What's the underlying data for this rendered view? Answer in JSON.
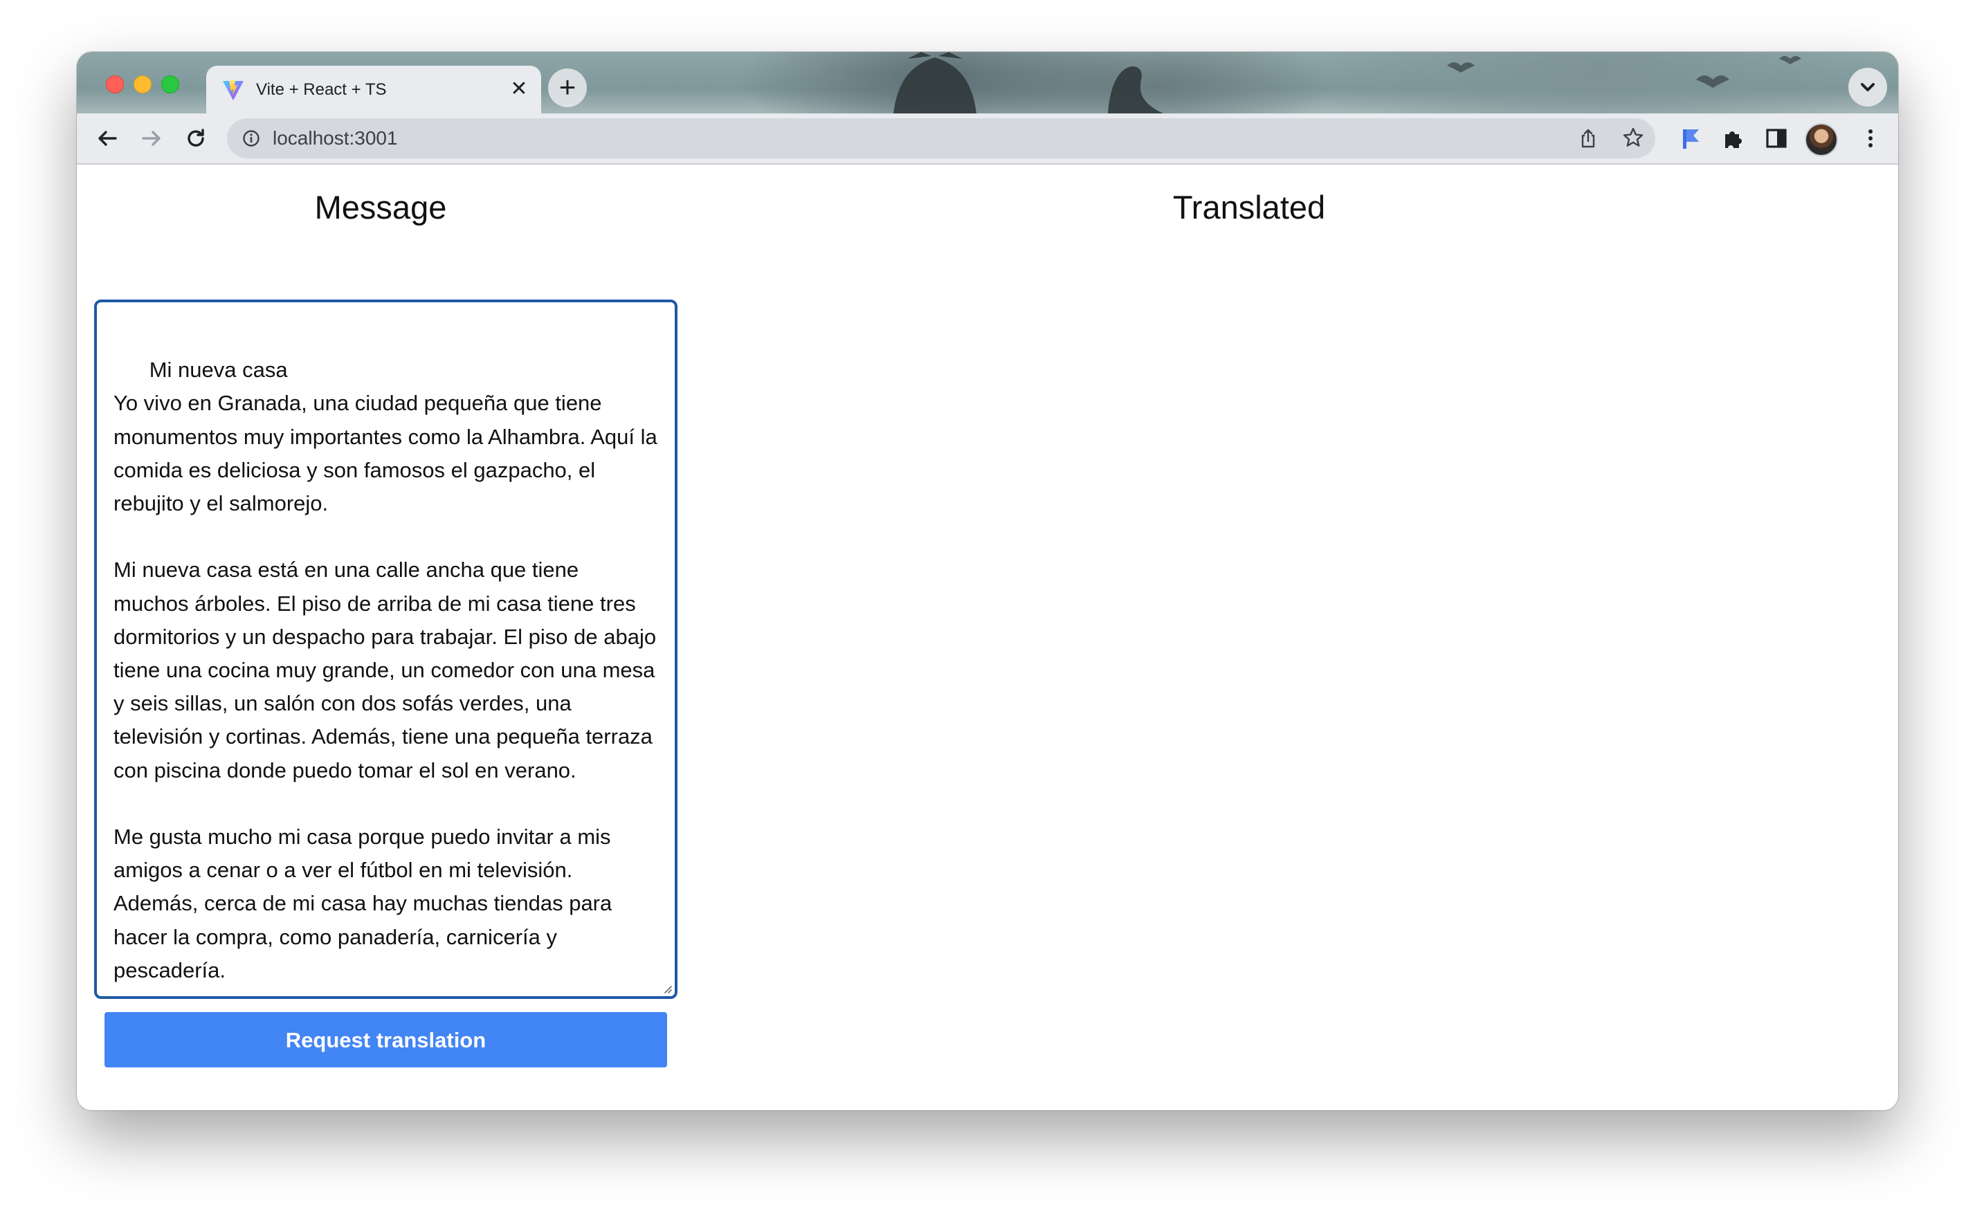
{
  "browser": {
    "tab_title": "Vite + React + TS",
    "tab_close": "✕",
    "new_tab": "+",
    "url": "localhost:3001"
  },
  "page": {
    "message_title": "Message",
    "translated_title": "Translated",
    "message_text": "Mi nueva casa\nYo vivo en Granada, una ciudad pequeña que tiene monumentos muy importantes como la Alhambra. Aquí la comida es deliciosa y son famosos el gazpacho, el rebujito y el salmorejo.\n\nMi nueva casa está en una calle ancha que tiene muchos árboles. El piso de arriba de mi casa tiene tres dormitorios y un despacho para trabajar. El piso de abajo tiene una cocina muy grande, un comedor con una mesa y seis sillas, un salón con dos sofás verdes, una televisión y cortinas. Además, tiene una pequeña terraza con piscina donde puedo tomar el sol en verano.\n\nMe gusta mucho mi casa porque puedo invitar a mis amigos a cenar o a ver el fútbol en mi televisión. Además, cerca de mi casa hay muchas tiendas para hacer la compra, como panadería, carnicería y pescadería.",
    "translated_text": "",
    "request_button": "Request translation"
  },
  "colors": {
    "button_bg": "#4285f4",
    "textarea_border": "#1e5aa6"
  },
  "icons": [
    "vite-logo-icon",
    "close-icon",
    "plus-icon",
    "chevron-down-icon",
    "back-arrow-icon",
    "forward-arrow-icon",
    "reload-icon",
    "info-icon",
    "share-icon",
    "star-icon",
    "bookmark-extension-icon",
    "puzzle-extensions-icon",
    "side-panel-icon",
    "avatar",
    "kebab-menu-icon"
  ]
}
